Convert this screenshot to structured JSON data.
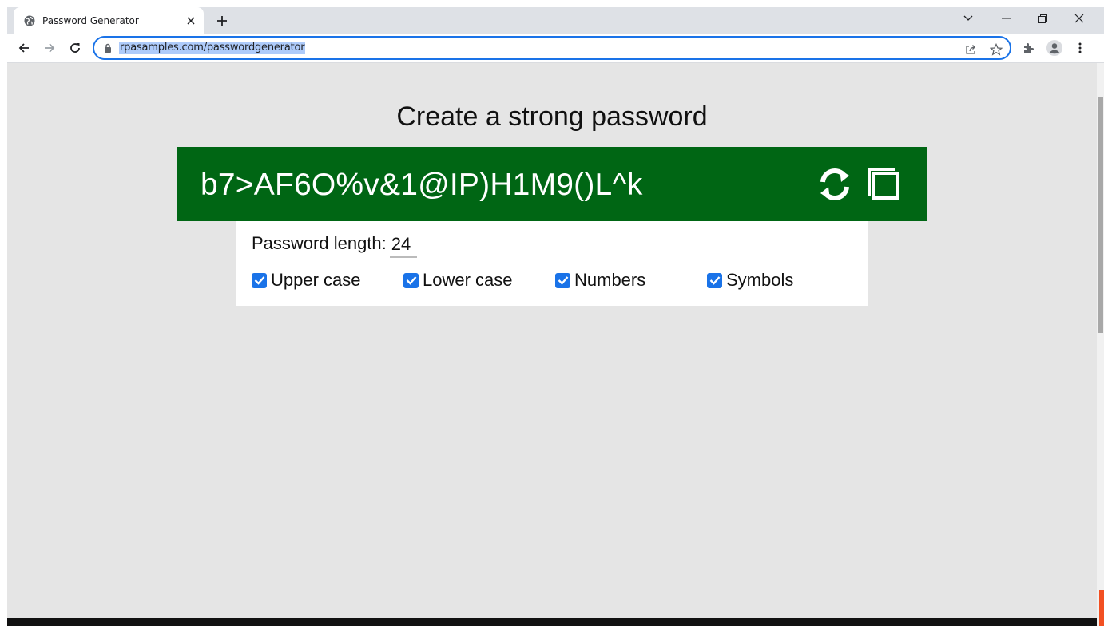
{
  "browser": {
    "tab": {
      "title": "Password Generator"
    },
    "address_bar": {
      "url": "rpasamples.com/passwordgenerator"
    }
  },
  "page": {
    "heading": "Create a strong password",
    "password": "b7>AF6O%v&1@IP)H1M9()L^k",
    "length_label": "Password length:",
    "length_value": "24",
    "options": [
      {
        "label": "Upper case",
        "checked": true
      },
      {
        "label": "Lower case",
        "checked": true
      },
      {
        "label": "Numbers",
        "checked": true
      },
      {
        "label": "Symbols",
        "checked": true
      }
    ]
  },
  "icons": {
    "tab_favicon": "globe-icon",
    "refresh_password": "sync-icon",
    "copy_password": "copy-icon"
  },
  "colors": {
    "password_banner": "#006614",
    "checkbox": "#1a73e8",
    "page_background": "#e5e5e5",
    "omnibox_border": "#1a73e8"
  }
}
